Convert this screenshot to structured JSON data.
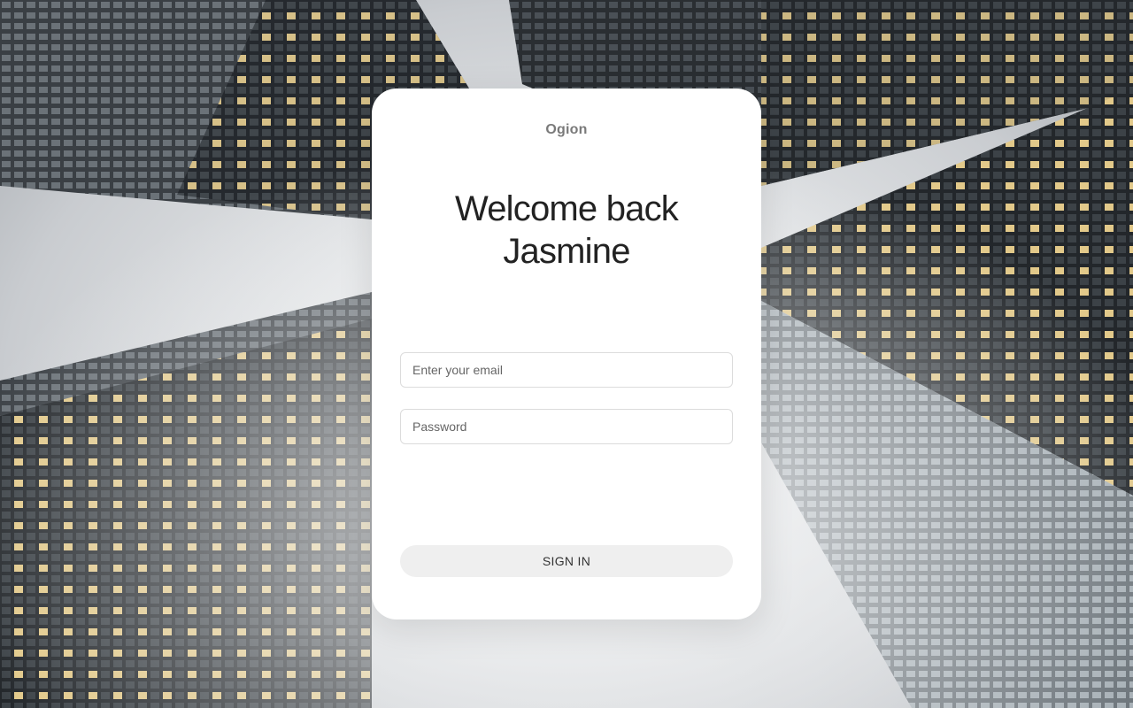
{
  "brand": "Ogion",
  "heading": {
    "line1": "Welcome back",
    "line2": "Jasmine"
  },
  "form": {
    "email_placeholder": "Enter your email",
    "password_placeholder": "Password",
    "submit_label": "SIGN IN"
  },
  "colors": {
    "card_background": "#ffffff",
    "button_background": "#efefef",
    "heading_text": "#222222",
    "brand_text": "#7a7a7a"
  }
}
